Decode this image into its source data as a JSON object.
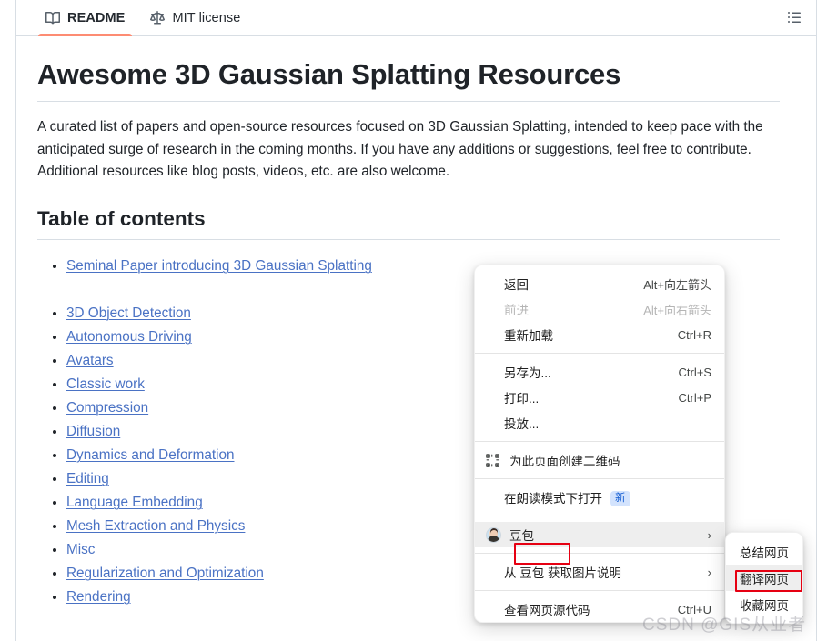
{
  "theme": {
    "accent": "#fd8c73",
    "link": "#4a72c4",
    "annotation": "#e60012",
    "border": "#d8dee4",
    "badge_bg": "#d3e3fd",
    "badge_fg": "#0b57d0"
  },
  "filebar": {
    "tabs": [
      {
        "label": "README",
        "icon": "book-icon",
        "active": true
      },
      {
        "label": "MIT license",
        "icon": "law-scale-icon",
        "active": false
      }
    ],
    "outline_button": {
      "icon": "list-unordered-icon",
      "label": "Outline"
    }
  },
  "readme": {
    "title": "Awesome 3D Gaussian Splatting Resources",
    "intro": "A curated list of papers and open-source resources focused on 3D Gaussian Splatting, intended to keep pace with the anticipated surge of research in the coming months. If you have any additions or suggestions, feel free to contribute. Additional resources like blog posts, videos, etc. are also welcome.",
    "toc_heading": "Table of contents",
    "toc": [
      {
        "label": "Seminal Paper introducing 3D Gaussian Splatting",
        "spaced": true
      },
      {
        "label": "3D Object Detection",
        "spaced": false
      },
      {
        "label": "Autonomous Driving",
        "spaced": false
      },
      {
        "label": "Avatars",
        "spaced": false
      },
      {
        "label": "Classic work",
        "spaced": false
      },
      {
        "label": "Compression",
        "spaced": false
      },
      {
        "label": "Diffusion",
        "spaced": false
      },
      {
        "label": "Dynamics and Deformation",
        "spaced": false
      },
      {
        "label": "Editing",
        "spaced": false
      },
      {
        "label": "Language Embedding",
        "spaced": false
      },
      {
        "label": "Mesh Extraction and Physics",
        "spaced": false
      },
      {
        "label": "Misc",
        "spaced": false
      },
      {
        "label": "Regularization and Optimization",
        "spaced": false
      },
      {
        "label": "Rendering",
        "spaced": false
      }
    ]
  },
  "context_menu": {
    "groups": [
      {
        "items": [
          {
            "label": "返回",
            "accel": "Alt+向左箭头",
            "disabled": false,
            "icon": null,
            "arrow": false,
            "hovered": false,
            "badge": null
          },
          {
            "label": "前进",
            "accel": "Alt+向右箭头",
            "disabled": true,
            "icon": null,
            "arrow": false,
            "hovered": false,
            "badge": null
          },
          {
            "label": "重新加载",
            "accel": "Ctrl+R",
            "disabled": false,
            "icon": null,
            "arrow": false,
            "hovered": false,
            "badge": null
          }
        ]
      },
      {
        "items": [
          {
            "label": "另存为...",
            "accel": "Ctrl+S",
            "disabled": false,
            "icon": null,
            "arrow": false,
            "hovered": false,
            "badge": null
          },
          {
            "label": "打印...",
            "accel": "Ctrl+P",
            "disabled": false,
            "icon": null,
            "arrow": false,
            "hovered": false,
            "badge": null
          },
          {
            "label": "投放...",
            "accel": "",
            "disabled": false,
            "icon": null,
            "arrow": false,
            "hovered": false,
            "badge": null
          }
        ]
      },
      {
        "items": [
          {
            "label": "为此页面创建二维码",
            "accel": "",
            "disabled": false,
            "icon": "qr-code-icon",
            "arrow": false,
            "hovered": false,
            "badge": null
          }
        ]
      },
      {
        "items": [
          {
            "label": "在朗读模式下打开",
            "accel": "",
            "disabled": false,
            "icon": null,
            "arrow": false,
            "hovered": false,
            "badge": "新"
          }
        ]
      },
      {
        "items": [
          {
            "label": "豆包",
            "accel": "",
            "disabled": false,
            "icon": "doubao-avatar-icon",
            "arrow": true,
            "hovered": true,
            "badge": null
          }
        ]
      },
      {
        "items": [
          {
            "label": "从 豆包 获取图片说明",
            "accel": "",
            "disabled": false,
            "icon": null,
            "arrow": true,
            "hovered": false,
            "badge": null
          }
        ]
      },
      {
        "items": [
          {
            "label": "查看网页源代码",
            "accel": "Ctrl+U",
            "disabled": false,
            "icon": null,
            "arrow": false,
            "hovered": false,
            "badge": null
          }
        ]
      }
    ]
  },
  "submenu": {
    "items": [
      {
        "label": "总结网页",
        "hovered": false
      },
      {
        "label": "翻译网页",
        "hovered": true
      },
      {
        "label": "收藏网页",
        "hovered": false
      }
    ]
  },
  "annotations": [
    {
      "name": "doubao-highlight",
      "target": "豆包"
    },
    {
      "name": "translate-highlight",
      "target": "翻译网页"
    }
  ],
  "watermark": {
    "text": "CSDN @GIS从业者"
  }
}
